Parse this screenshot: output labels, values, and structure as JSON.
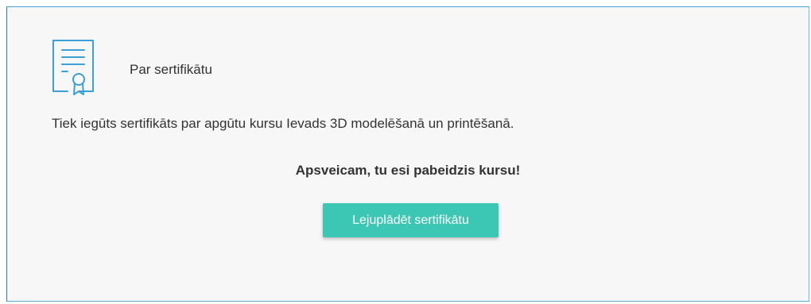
{
  "header": {
    "icon": "certificate-icon",
    "title": "Par sertifikātu"
  },
  "description": "Tiek iegūts sertifikāts par apgūtu kursu Ievads 3D modelēšanā un printēšanā.",
  "congrats": "Apsveicam, tu esi pabeidzis kursu!",
  "download_button": {
    "label": "Lejuplādēt sertifikātu"
  },
  "colors": {
    "accent": "#3cc6b4",
    "icon": "#3b9fd8",
    "text": "#333333",
    "card_background": "#f7f7f8"
  }
}
